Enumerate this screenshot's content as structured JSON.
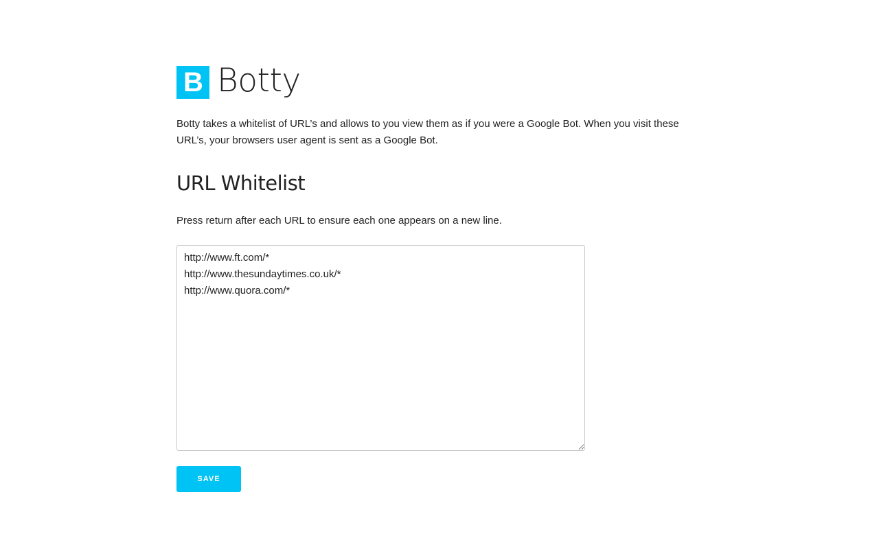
{
  "brand": {
    "logo_letter": "B",
    "name": "Botty",
    "accent_color": "#00c3f5"
  },
  "intro": {
    "text": "Botty takes a whitelist of URL’s and allows to you view them as if you were a Google Bot. When you visit these URL’s, your browsers user agent is sent as a Google Bot."
  },
  "whitelist": {
    "title": "URL Whitelist",
    "hint": "Press return after each URL to ensure each one appears on a new line.",
    "urls_text": "http://www.ft.com/*\nhttp://www.thesundaytimes.co.uk/*\nhttp://www.quora.com/*"
  },
  "actions": {
    "save_label": "SAVE"
  }
}
